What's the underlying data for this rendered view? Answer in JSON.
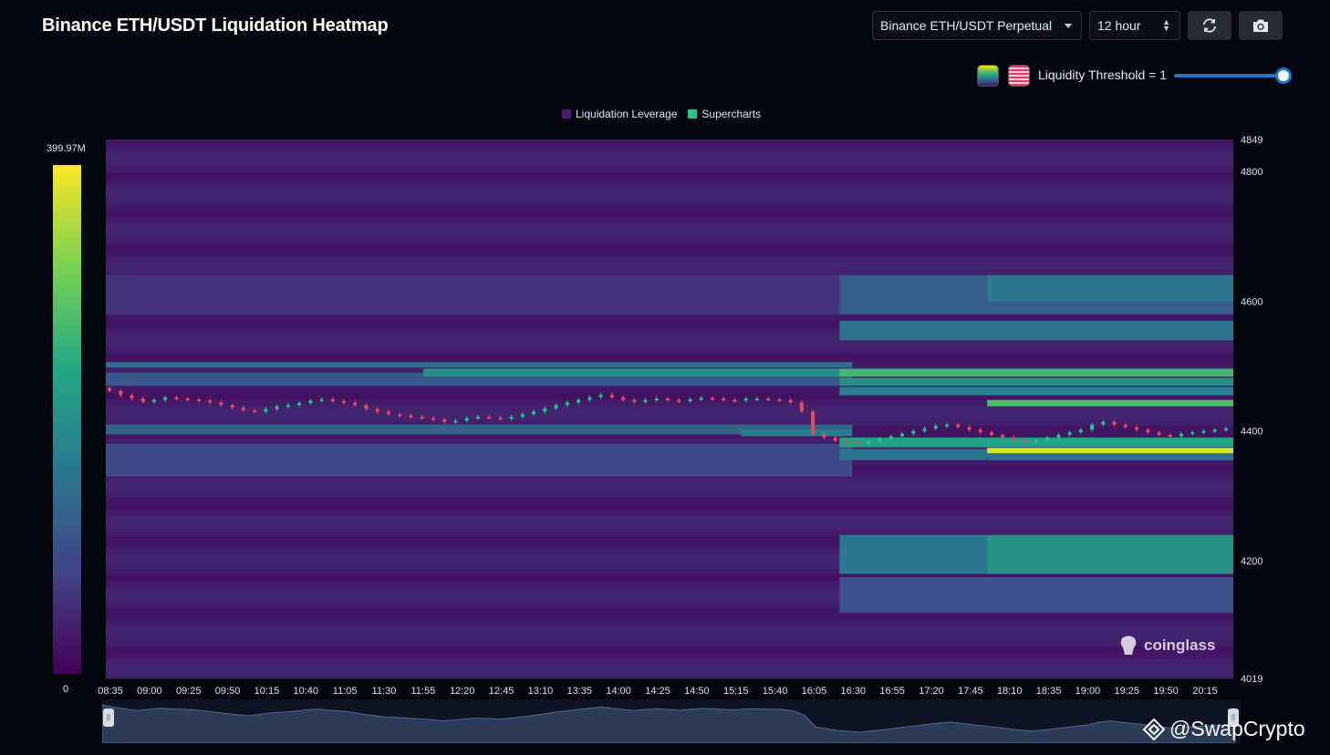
{
  "header": {
    "title": "Binance ETH/USDT Liquidation Heatmap",
    "pair_select": "Binance ETH/USDT Perpetual",
    "range_select": "12 hour",
    "refresh_icon": "refresh-icon",
    "camera_icon": "camera-icon"
  },
  "controls": {
    "palette_icons": [
      "viridis-palette-icon",
      "pink-palette-icon"
    ],
    "threshold_label": "Liquidity Threshold = 1",
    "threshold_value": 1,
    "slider_fraction": 1.0
  },
  "legend": {
    "items": [
      {
        "label": "Liquidation Leverage",
        "color": "#4b1a6e"
      },
      {
        "label": "Supercharts",
        "color": "#1ec88a"
      }
    ]
  },
  "colorbar": {
    "max_label": "399.97M",
    "min_label": "0"
  },
  "watermark": {
    "text": "coinglass"
  },
  "credit": {
    "text": "@SwapCrypto"
  },
  "chart_data": {
    "type": "heatmap",
    "colorscale": "viridis",
    "x_tick_labels": [
      "08:35",
      "09:00",
      "09:25",
      "09:50",
      "10:15",
      "10:40",
      "11:05",
      "11:30",
      "11:55",
      "12:20",
      "12:45",
      "13:10",
      "13:35",
      "14:00",
      "14:25",
      "14:50",
      "15:15",
      "15:40",
      "16:05",
      "16:30",
      "16:55",
      "17:20",
      "17:45",
      "18:10",
      "18:35",
      "19:00",
      "19:25",
      "19:50",
      "20:15"
    ],
    "y_tick_labels": [
      "4849",
      "4800",
      "4600",
      "4400",
      "4200",
      "4019"
    ],
    "y_ticks": [
      4849,
      4800,
      4600,
      4400,
      4200,
      4019
    ],
    "ylim": [
      4019,
      4849
    ],
    "x_range_minutes": [
      0,
      710
    ],
    "value_range": [
      0,
      399.97
    ],
    "value_unit": "M",
    "heat_bands": [
      {
        "x": [
          0,
          470
        ],
        "y": [
          4498,
          4506
        ],
        "value": 150
      },
      {
        "x": [
          0,
          470
        ],
        "y": [
          4470,
          4490
        ],
        "value": 110
      },
      {
        "x": [
          0,
          470
        ],
        "y": [
          4395,
          4410
        ],
        "value": 130
      },
      {
        "x": [
          0,
          470
        ],
        "y": [
          4330,
          4380
        ],
        "value": 90
      },
      {
        "x": [
          0,
          470
        ],
        "y": [
          4580,
          4640
        ],
        "value": 60
      },
      {
        "x": [
          200,
          470
        ],
        "y": [
          4484,
          4496
        ],
        "value": 200
      },
      {
        "x": [
          400,
          470
        ],
        "y": [
          4392,
          4402
        ],
        "value": 170
      },
      {
        "x": [
          462,
          710
        ],
        "y": [
          4484,
          4496
        ],
        "value": 270
      },
      {
        "x": [
          462,
          710
        ],
        "y": [
          4470,
          4482
        ],
        "value": 200
      },
      {
        "x": [
          462,
          710
        ],
        "y": [
          4455,
          4468
        ],
        "value": 170
      },
      {
        "x": [
          462,
          710
        ],
        "y": [
          4540,
          4570
        ],
        "value": 150
      },
      {
        "x": [
          462,
          710
        ],
        "y": [
          4580,
          4640
        ],
        "value": 120
      },
      {
        "x": [
          462,
          710
        ],
        "y": [
          4375,
          4390
        ],
        "value": 230
      },
      {
        "x": [
          462,
          710
        ],
        "y": [
          4355,
          4372
        ],
        "value": 150
      },
      {
        "x": [
          462,
          710
        ],
        "y": [
          4180,
          4240
        ],
        "value": 160
      },
      {
        "x": [
          462,
          710
        ],
        "y": [
          4120,
          4175
        ],
        "value": 100
      },
      {
        "x": [
          555,
          710
        ],
        "y": [
          4438,
          4448
        ],
        "value": 280
      },
      {
        "x": [
          555,
          710
        ],
        "y": [
          4366,
          4374
        ],
        "value": 380
      },
      {
        "x": [
          555,
          710
        ],
        "y": [
          4600,
          4640
        ],
        "value": 160
      },
      {
        "x": [
          555,
          710
        ],
        "y": [
          4180,
          4240
        ],
        "value": 200
      }
    ],
    "price_ohlc_close": [
      4462,
      4455,
      4450,
      4445,
      4448,
      4452,
      4450,
      4449,
      4447,
      4444,
      4440,
      4436,
      4432,
      4430,
      4434,
      4438,
      4440,
      4443,
      4447,
      4449,
      4446,
      4444,
      4440,
      4434,
      4430,
      4426,
      4424,
      4422,
      4420,
      4418,
      4414,
      4416,
      4420,
      4422,
      4421,
      4419,
      4422,
      4426,
      4430,
      4435,
      4440,
      4444,
      4448,
      4452,
      4456,
      4452,
      4448,
      4445,
      4448,
      4450,
      4448,
      4446,
      4449,
      4451,
      4450,
      4448,
      4447,
      4450,
      4450,
      4449,
      4448,
      4444,
      4430,
      4395,
      4390,
      4385,
      4382,
      4380,
      4384,
      4388,
      4392,
      4396,
      4400,
      4404,
      4408,
      4410,
      4406,
      4402,
      4398,
      4394,
      4390,
      4386,
      4384,
      4386,
      4390,
      4394,
      4398,
      4402,
      4410,
      4414,
      4410,
      4406,
      4402,
      4398,
      4394,
      4392,
      4396,
      4398,
      4400,
      4402,
      4404
    ],
    "volume_overview": "area"
  }
}
